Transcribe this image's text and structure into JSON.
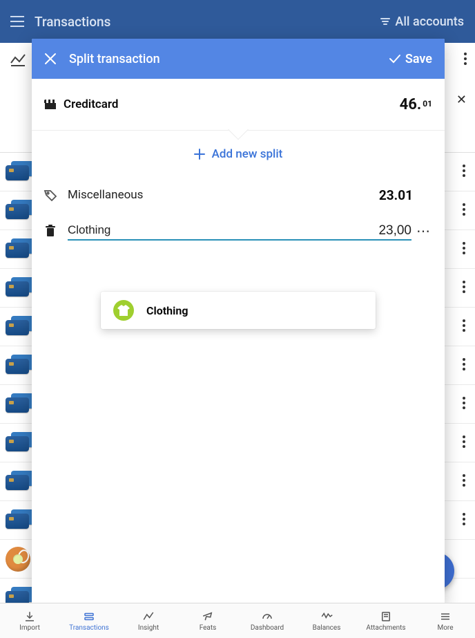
{
  "topbar": {
    "title": "Transactions",
    "accounts_label": "All accounts"
  },
  "modal": {
    "title": "Split transaction",
    "save_label": "Save",
    "account_name": "Creditcard",
    "total_major": "46.",
    "total_cents": "01",
    "add_split_label": "Add new split"
  },
  "splits": [
    {
      "category": "Miscellaneous",
      "amount": "23.01"
    }
  ],
  "editing": {
    "category_value": "Clothing",
    "amount_value": "23,00"
  },
  "suggestion": {
    "label": "Clothing"
  },
  "bottom_nav": {
    "items": [
      {
        "label": "Import"
      },
      {
        "label": "Transactions"
      },
      {
        "label": "Insight"
      },
      {
        "label": "Feats"
      },
      {
        "label": "Dashboard"
      },
      {
        "label": "Balances"
      },
      {
        "label": "Attachments"
      },
      {
        "label": "More"
      }
    ]
  }
}
